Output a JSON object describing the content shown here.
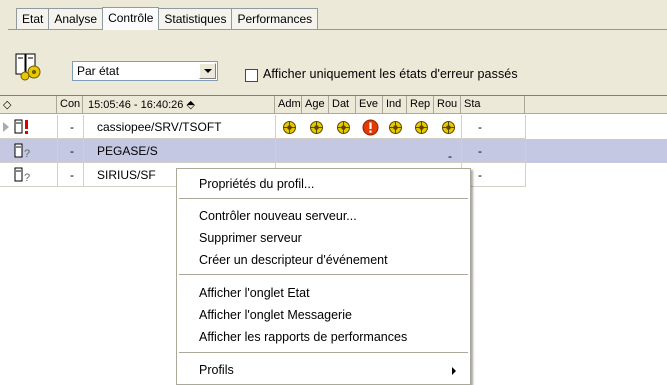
{
  "tabs": [
    "Etat",
    "Analyse",
    "Contrôle",
    "Statistiques",
    "Performances"
  ],
  "active_tab_index": 2,
  "filter": {
    "selected": "Par état"
  },
  "checkbox": {
    "label": "Afficher uniquement les états d'erreur passés",
    "checked": false
  },
  "columns": {
    "status": "◇",
    "con": "Con",
    "time_range": "15:05:46 - 16:40:26 ⬘",
    "agents": [
      "Adm",
      "Age",
      "Dat",
      "Eve",
      "Ind",
      "Rep",
      "Rou",
      "Sta"
    ]
  },
  "rows": [
    {
      "con": "-",
      "name": "cassiopee/SRV/TSOFT",
      "state": "error",
      "sta": "-"
    },
    {
      "con": "-",
      "name": "PEGASE/SRV/TSOFT",
      "state": "unknown",
      "sta": "-",
      "selected": true
    },
    {
      "con": "-",
      "name": "SIRIUS/SRV/TSOFT",
      "state": "unknown",
      "sta": "-"
    }
  ],
  "row_visible_names": [
    "cassiopee/SRV/TSOFT",
    "PEGASE/S",
    "SIRIUS/SF"
  ],
  "row_dashes": [
    "-",
    "-"
  ],
  "menu": {
    "group1": [
      "Propriétés du profil..."
    ],
    "group2": [
      "Contrôler nouveau serveur...",
      "Supprimer serveur",
      "Créer un descripteur d'événement"
    ],
    "group3": [
      "Afficher l'onglet Etat",
      "Afficher l'onglet Messagerie",
      "Afficher les rapports de performances"
    ],
    "group4": [
      "Profils"
    ]
  },
  "colors": {
    "selection": "#c5c8e3",
    "error": "#e23a00",
    "panel": "#ece9d8"
  }
}
